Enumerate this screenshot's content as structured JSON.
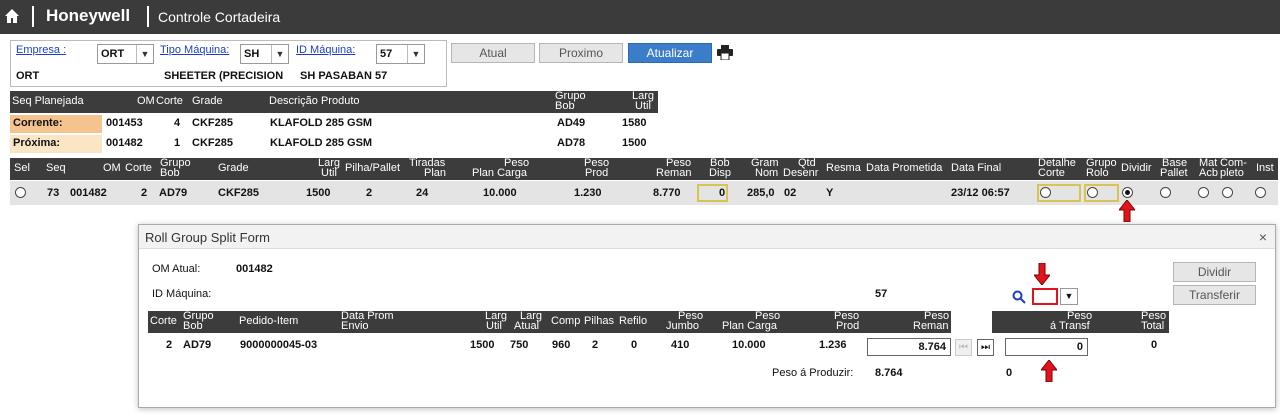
{
  "topbar": {
    "brand": "Honeywell",
    "page_title": "Controle Cortadeira"
  },
  "selectors": {
    "empresa": {
      "label": "Empresa :",
      "value": "ORT",
      "desc": "ORT"
    },
    "tipo_maquina": {
      "label": "Tipo Máquina:",
      "value": "SH",
      "desc": "SHEETER (PRECISION"
    },
    "id_maquina": {
      "label": "ID Máquina:",
      "value": "57",
      "desc": "SH PASABAN 57"
    }
  },
  "buttons": {
    "atual": "Atual",
    "proximo": "Proximo",
    "atualizar": "Atualizar"
  },
  "plan": {
    "headers": {
      "seq": "Seq Planejada",
      "om": "OM",
      "corte": "Corte",
      "grade": "Grade",
      "desc": "Descrição Produto",
      "grupo1": "Grupo",
      "grupo2": "Bob",
      "larg1": "Larg",
      "larg2": "Util"
    },
    "corrente": {
      "label": "Corrente:",
      "om": "001453",
      "corte": "4",
      "grade": "CKF285",
      "desc": "KLAFOLD 285 GSM",
      "grupo": "AD49",
      "larg": "1580"
    },
    "proxima": {
      "label": "Próxima:",
      "om": "001482",
      "corte": "1",
      "grade": "CKF285",
      "desc": "KLAFOLD 285 GSM",
      "grupo": "AD78",
      "larg": "1500"
    }
  },
  "grid": {
    "headers": {
      "sel": "Sel",
      "seq": "Seq",
      "om": "OM",
      "corte": "Corte",
      "grupo1": "Grupo",
      "grupo2": "Bob",
      "grade": "Grade",
      "larg1": "Larg",
      "larg2": "Util",
      "pilha": "Pilha/Pallet",
      "tir1": "Tiradas",
      "tir2": "Plan",
      "pp1": "Peso",
      "pp2": "Plan Carga",
      "prod1": "Peso",
      "prod2": "Prod",
      "rem1": "Peso",
      "rem2": "Reman",
      "bob1": "Bob",
      "bob2": "Disp",
      "gram1": "Gram",
      "gram2": "Nom",
      "qtd1": "Qtd",
      "qtd2": "Desenr",
      "resma": "Resma",
      "dprom": "Data Prometida",
      "dfinal": "Data Final",
      "det1": "Detalhe",
      "det2": "Corte",
      "gr1": "Grupo",
      "gr2": "Rolo",
      "dividir": "Dividir",
      "base1": "Base",
      "base2": "Pallet",
      "mat1": "Mat",
      "mat2": "Acb",
      "comp1": "Com-",
      "comp2": "pleto",
      "inst": "Inst"
    },
    "row": {
      "seq": "73",
      "om": "001482",
      "corte": "2",
      "grupo": "AD79",
      "grade": "CKF285",
      "larg": "1500",
      "pilha": "2",
      "tiradas": "24",
      "peso_plan": "10.000",
      "peso_prod": "1.230",
      "peso_rem": "8.770",
      "bob": "0",
      "gram": "285,0",
      "qtd": "02",
      "resma": "Y",
      "dfinal": "23/12 06:57"
    }
  },
  "modal": {
    "title": "Roll Group Split Form",
    "om_label": "OM Atual:",
    "om_value": "001482",
    "id_label": "ID Máquina:",
    "id_value": "57",
    "btn_dividir": "Dividir",
    "btn_transferir": "Transferir",
    "headers": {
      "corte": "Corte",
      "grupo1": "Grupo",
      "grupo2": "Bob",
      "pedido": "Pedido-Item",
      "dp1": "Data Prom",
      "dp2": "Envio",
      "lu1": "Larg",
      "lu2": "Util",
      "la1": "Larg",
      "la2": "Atual",
      "comp": "Comp",
      "pilhas": "Pilhas",
      "refilo": "Refilo",
      "pj1": "Peso",
      "pj2": "Jumbo",
      "ppc1": "Peso",
      "ppc2": "Plan Carga",
      "pp1": "Peso",
      "pp2": "Prod",
      "pr1": "Peso",
      "pr2": "Reman",
      "pt1": "Peso",
      "pt2": "á Transf",
      "ptot1": "Peso",
      "ptot2": "Total"
    },
    "row": {
      "corte": "2",
      "grupo": "AD79",
      "pedido": "9000000045-03",
      "larg_util": "1500",
      "larg_atual": "750",
      "comp": "960",
      "pilhas": "2",
      "refilo": "0",
      "peso_jumbo": "410",
      "peso_plan": "10.000",
      "peso_prod": "1.236",
      "peso_reman": "8.764",
      "peso_transf": "0",
      "peso_total": "0"
    },
    "produzir_label": "Peso á Produzir:",
    "produzir_value": "8.764",
    "produzir_extra": "0"
  },
  "colors": {
    "topbar": "#3b3b3b",
    "primary": "#3b7dc8",
    "corrente": "#f5c48e",
    "proxima": "#fae6c4",
    "highlight": "#d6c455",
    "arrow": "#e0141a"
  }
}
